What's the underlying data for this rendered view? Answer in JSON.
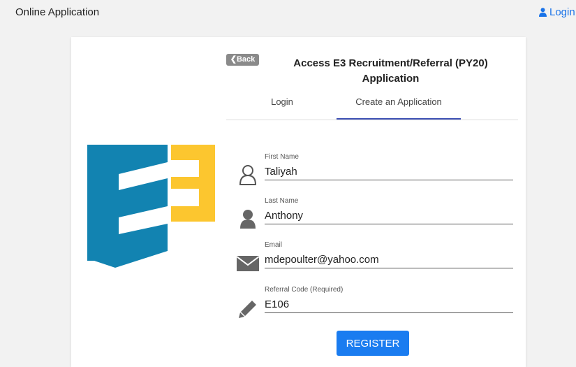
{
  "topbar": {
    "title": "Online Application",
    "login_label": "Login"
  },
  "card": {
    "back_label": "Back",
    "heading": "Access E3 Recruitment/Referral (PY20) Application",
    "tabs": [
      {
        "label": "Login",
        "active": false
      },
      {
        "label": "Create an Application",
        "active": true
      }
    ],
    "fields": {
      "first_name": {
        "label": "First Name",
        "value": "Taliyah",
        "icon": "user-outline-icon"
      },
      "last_name": {
        "label": "Last Name",
        "value": "Anthony",
        "icon": "user-solid-icon"
      },
      "email": {
        "label": "Email",
        "value": "mdepoulter@yahoo.com",
        "icon": "envelope-icon"
      },
      "referral_code": {
        "label": "Referral Code (Required)",
        "value": "E106",
        "icon": "pencil-icon"
      }
    },
    "register_label": "REGISTER"
  },
  "colors": {
    "accent": "#1a7cf0",
    "tab_indicator": "#3f51b5",
    "logo_blue": "#1283b1",
    "logo_yellow": "#fcc62f"
  }
}
